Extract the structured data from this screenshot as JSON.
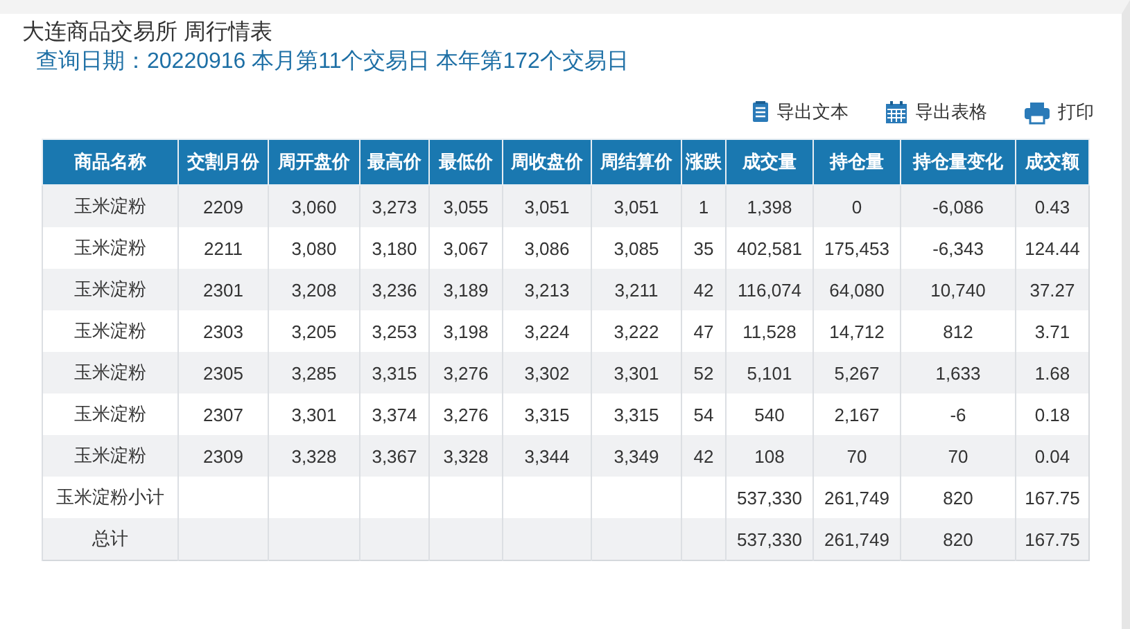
{
  "title": "大连商品交易所 周行情表",
  "query_line": "查询日期：20220916 本月第11个交易日 本年第172个交易日",
  "toolbar": [
    {
      "kind": "text",
      "label": "导出文本"
    },
    {
      "kind": "sheet",
      "label": "导出表格"
    },
    {
      "kind": "print",
      "label": "打印"
    }
  ],
  "table": {
    "columns": [
      "商品名称",
      "交割月份",
      "周开盘价",
      "最高价",
      "最低价",
      "周收盘价",
      "周结算价",
      "涨跌",
      "成交量",
      "持仓量",
      "持仓量变化",
      "成交额"
    ],
    "rows": [
      {
        "kind": "data",
        "cells": [
          "玉米淀粉",
          "2209",
          "3,060",
          "3,273",
          "3,055",
          "3,051",
          "3,051",
          "1",
          "1,398",
          "0",
          "-6,086",
          "0.43"
        ]
      },
      {
        "kind": "data",
        "cells": [
          "玉米淀粉",
          "2211",
          "3,080",
          "3,180",
          "3,067",
          "3,086",
          "3,085",
          "35",
          "402,581",
          "175,453",
          "-6,343",
          "124.44"
        ]
      },
      {
        "kind": "data",
        "cells": [
          "玉米淀粉",
          "2301",
          "3,208",
          "3,236",
          "3,189",
          "3,213",
          "3,211",
          "42",
          "116,074",
          "64,080",
          "10,740",
          "37.27"
        ]
      },
      {
        "kind": "data",
        "cells": [
          "玉米淀粉",
          "2303",
          "3,205",
          "3,253",
          "3,198",
          "3,224",
          "3,222",
          "47",
          "11,528",
          "14,712",
          "812",
          "3.71"
        ]
      },
      {
        "kind": "data",
        "cells": [
          "玉米淀粉",
          "2305",
          "3,285",
          "3,315",
          "3,276",
          "3,302",
          "3,301",
          "52",
          "5,101",
          "5,267",
          "1,633",
          "1.68"
        ]
      },
      {
        "kind": "data",
        "cells": [
          "玉米淀粉",
          "2307",
          "3,301",
          "3,374",
          "3,276",
          "3,315",
          "3,315",
          "54",
          "540",
          "2,167",
          "-6",
          "0.18"
        ]
      },
      {
        "kind": "data",
        "cells": [
          "玉米淀粉",
          "2309",
          "3,328",
          "3,367",
          "3,328",
          "3,344",
          "3,349",
          "42",
          "108",
          "70",
          "70",
          "0.04"
        ]
      },
      {
        "kind": "total",
        "cells": [
          "玉米淀粉小计",
          "537,330",
          "261,749",
          "820",
          "167.75"
        ]
      },
      {
        "kind": "total",
        "cells": [
          "总计",
          "537,330",
          "261,749",
          "820",
          "167.75"
        ]
      }
    ]
  }
}
